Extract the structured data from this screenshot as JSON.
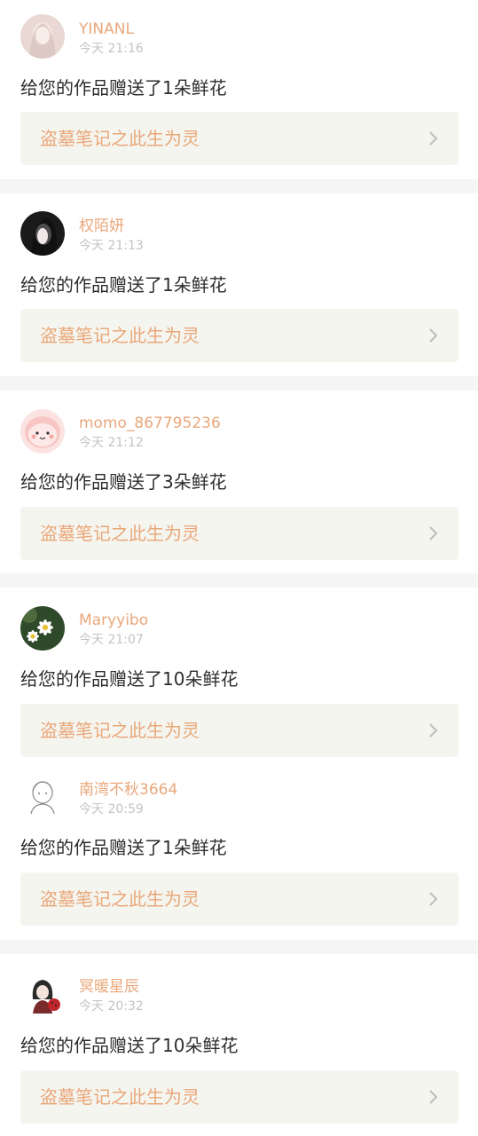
{
  "notifications": [
    {
      "username": "YINANL",
      "time": "今天 21:16",
      "message": "给您的作品赠送了1朵鲜花",
      "work_title": "盗墓笔记之此生为灵"
    },
    {
      "username": "权陌妍",
      "time": "今天 21:13",
      "message": "给您的作品赠送了1朵鲜花",
      "work_title": "盗墓笔记之此生为灵"
    },
    {
      "username": "momo_867795236",
      "time": "今天 21:12",
      "message": "给您的作品赠送了3朵鲜花",
      "work_title": "盗墓笔记之此生为灵"
    },
    {
      "username": "Maryyibo",
      "time": "今天 21:07",
      "message": "给您的作品赠送了10朵鲜花",
      "work_title": "盗墓笔记之此生为灵"
    },
    {
      "username": "南湾不秋3664",
      "time": "今天 20:59",
      "message": "给您的作品赠送了1朵鲜花",
      "work_title": "盗墓笔记之此生为灵"
    },
    {
      "username": "冥暖星辰",
      "time": "今天 20:32",
      "message": "给您的作品赠送了10朵鲜花",
      "work_title": "盗墓笔记之此生为灵"
    }
  ],
  "colors": {
    "accent": "#e9a77a",
    "time": "#c4c4c4",
    "text": "#2d2d2d",
    "link_bg": "#f5f5ef",
    "divider": "#f5f5f5"
  },
  "icons": [
    "chevron-right-icon"
  ]
}
